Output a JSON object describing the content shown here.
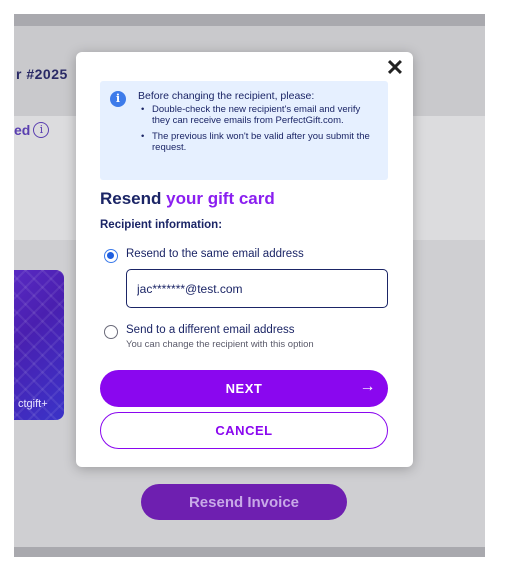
{
  "background": {
    "order_number": "r #2025",
    "status_text": "ed",
    "gift_card_brand": "ctgift+",
    "resend_invoice_label": "Resend Invoice"
  },
  "modal": {
    "close_symbol": "✕",
    "notice": {
      "icon": "info-icon",
      "title": "Before changing the recipient, please:",
      "items": [
        "Double-check the new recipient's email and verify they can receive emails from PerfectGift.com.",
        "The previous link won't be valid after you submit the request."
      ]
    },
    "heading_plain": "Resend ",
    "heading_accent": "your gift card",
    "recipient_label": "Recipient information:",
    "option_same": {
      "label": "Resend to the same email address",
      "selected": true
    },
    "email_value": "jac*******@test.com",
    "option_different": {
      "label": "Send to a different email address",
      "hint": "You can change the recipient with this option",
      "selected": false
    },
    "next_label": "NEXT",
    "next_arrow": "→",
    "cancel_label": "CANCEL"
  },
  "colors": {
    "primary": "#8a07ef",
    "navy": "#1b2566",
    "notice_bg": "#e6f0ff",
    "info_blue": "#3d7bea"
  }
}
